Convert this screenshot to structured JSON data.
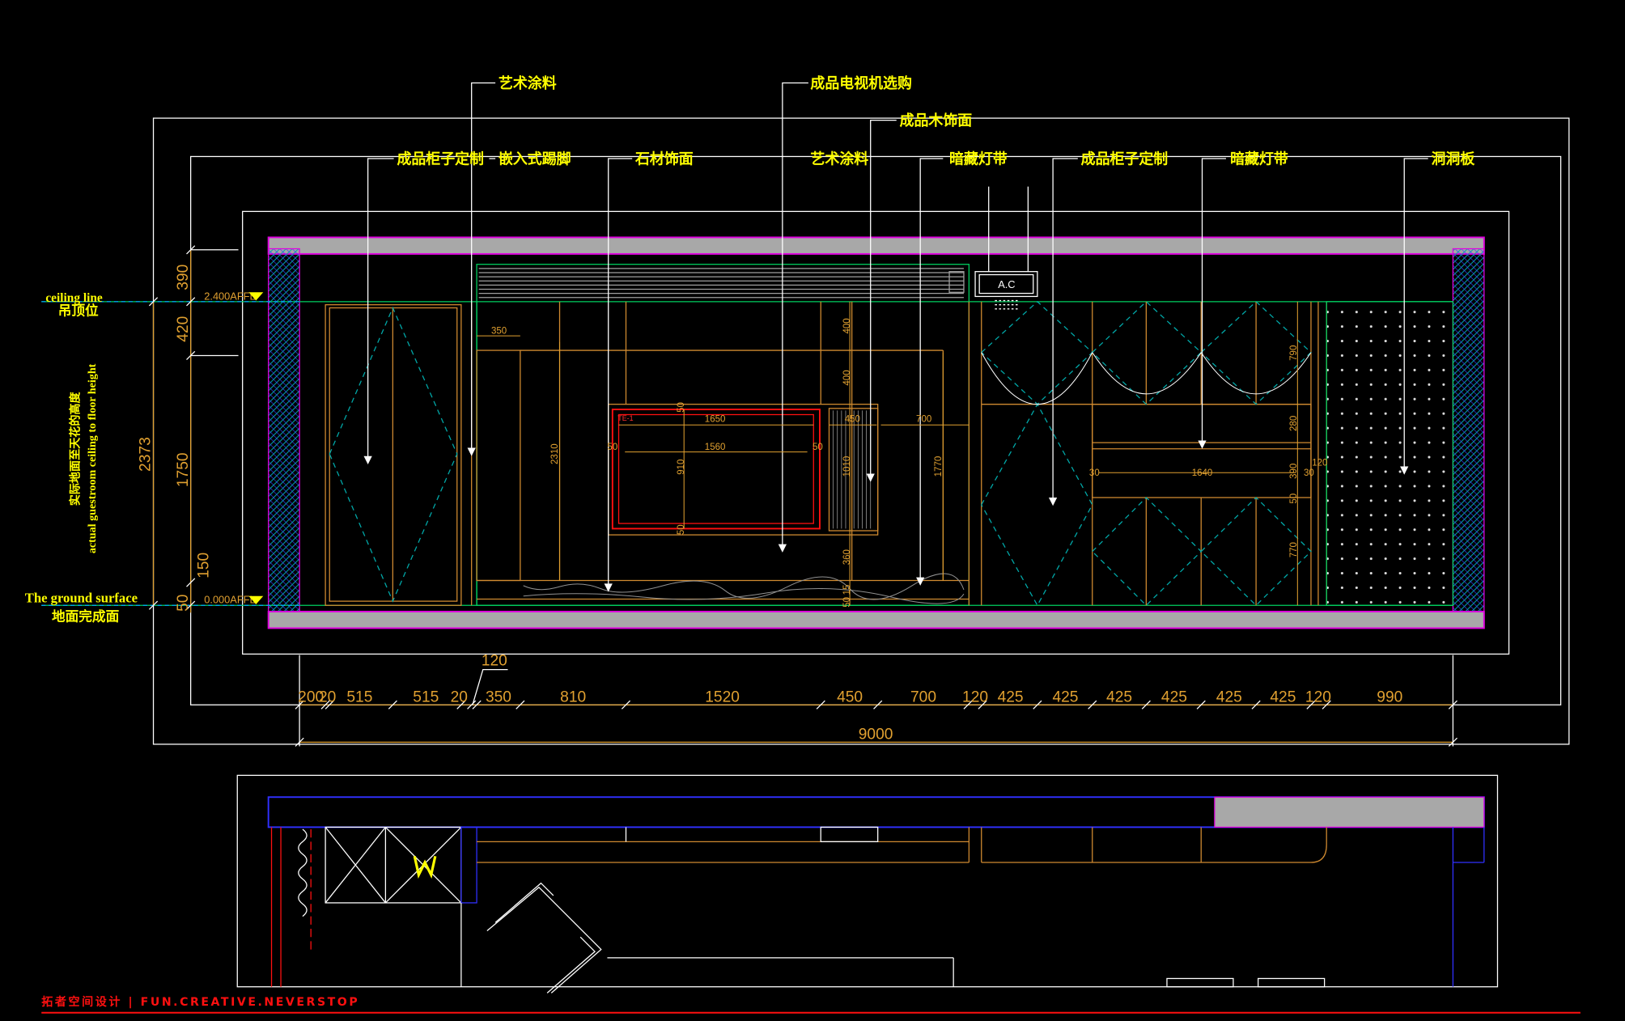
{
  "colors": {
    "background": "#000000",
    "frame": "#ffffff",
    "dimension": "#e0a030",
    "label": "#ffff00",
    "slab": "#a8a8a8",
    "slab_edge": "#e000e0",
    "ceiling_line": "#00d060",
    "cabinet": "#d08a30",
    "hidden": "#00a8a8",
    "red": "#ff1010",
    "blue": "#3030ff"
  },
  "callouts": {
    "art_paint_top": "艺术涂料",
    "tv": "成品电视机选购",
    "wood_finish": "成品木饰面",
    "cabinet_left": "成品柜子定制",
    "kick": "嵌入式踢脚",
    "stone": "石材饰面",
    "art_paint_mid": "艺术涂料",
    "led_left": "暗藏灯带",
    "cabinet_right": "成品柜子定制",
    "led_right": "暗藏灯带",
    "perforated": "洞洞板"
  },
  "left_notes": {
    "ceiling_en": "ceiling line",
    "ceiling_cn": "吊顶位",
    "height_cn": "实际地面至天花的高度",
    "height_en": "actual guestroom ceiling to floor height",
    "ground_en": "The ground surface",
    "ground_cn": "地面完成面"
  },
  "level_marks": {
    "top": "2.400AFFL",
    "bottom": "0.000AFFL"
  },
  "ac_label": "A.C",
  "vertical_dims": {
    "d390": "390",
    "d420": "420",
    "d2373": "2373",
    "d1750": "1750",
    "d150": "150",
    "d50": "50"
  },
  "horizontal_dims": {
    "segments": [
      "200",
      "20",
      "515",
      "515",
      "20",
      "350",
      "810",
      "1520",
      "450",
      "700",
      "120",
      "425",
      "425",
      "425",
      "425",
      "425",
      "425",
      "120",
      "990"
    ],
    "extra_120": "120",
    "total": "9000"
  },
  "inner_dims": {
    "d350": "350",
    "d1650": "1650",
    "d1560": "1560",
    "d50a": "50",
    "d50b": "50",
    "d50c": "50",
    "d50d": "50",
    "d910": "910",
    "d450": "450",
    "d700": "700",
    "d400a": "400",
    "d400b": "400",
    "d1010": "1010",
    "d2310": "2310",
    "d1770": "1770",
    "d360": "360",
    "d50e": "50",
    "d15": "15",
    "d790": "790",
    "d280": "280",
    "d390b": "390",
    "d770": "770",
    "d1640": "1640",
    "d30a": "30",
    "d30b": "30",
    "d120": "120",
    "d50f": "50",
    "tag": "TE-1"
  },
  "footer": "拓者空间设计 | FUN.CREATIVE.NEVERSTOP"
}
